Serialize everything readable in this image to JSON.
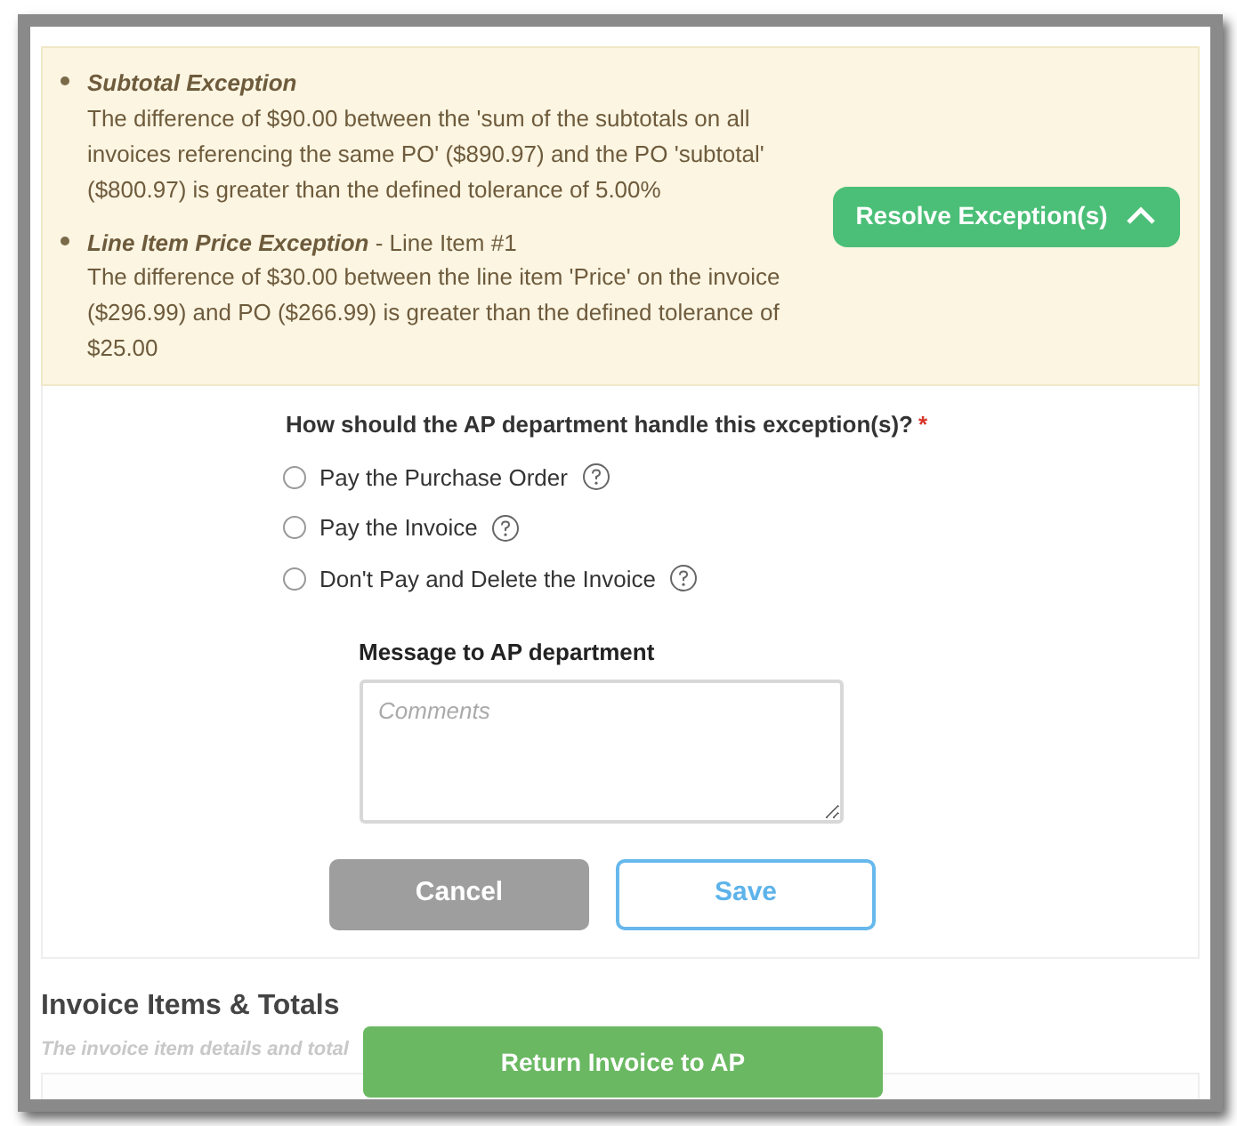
{
  "exceptions": [
    {
      "title": "Subtotal Exception",
      "text": "The difference of $90.00 between the 'sum of the subtotals on all invoices referencing the same PO' ($890.97) and the PO 'subtotal' ($800.97) is greater than the defined tolerance of 5.00%"
    },
    {
      "title": "Line Item Price Exception",
      "suffix": " - Line Item #1",
      "text": "The difference of $30.00 between the line item 'Price' on the invoice ($296.99) and PO ($266.99) is greater than the defined tolerance of $25.00"
    }
  ],
  "resolve_button": {
    "label": "Resolve Exception(s)",
    "expanded": true
  },
  "question": {
    "label": "How should the AP department handle this exception(s)?",
    "required": true,
    "required_mark": "*"
  },
  "options": [
    {
      "label": "Pay the Purchase Order",
      "selected": false
    },
    {
      "label": "Pay the Invoice",
      "selected": false
    },
    {
      "label": "Don't Pay and Delete the Invoice",
      "selected": false
    }
  ],
  "message": {
    "label": "Message to AP department",
    "placeholder": "Comments"
  },
  "buttons": {
    "cancel": "Cancel",
    "save": "Save"
  },
  "section": {
    "title": "Invoice Items & Totals",
    "subtitle": "The invoice item details and total"
  },
  "return_button": "Return Invoice to AP"
}
